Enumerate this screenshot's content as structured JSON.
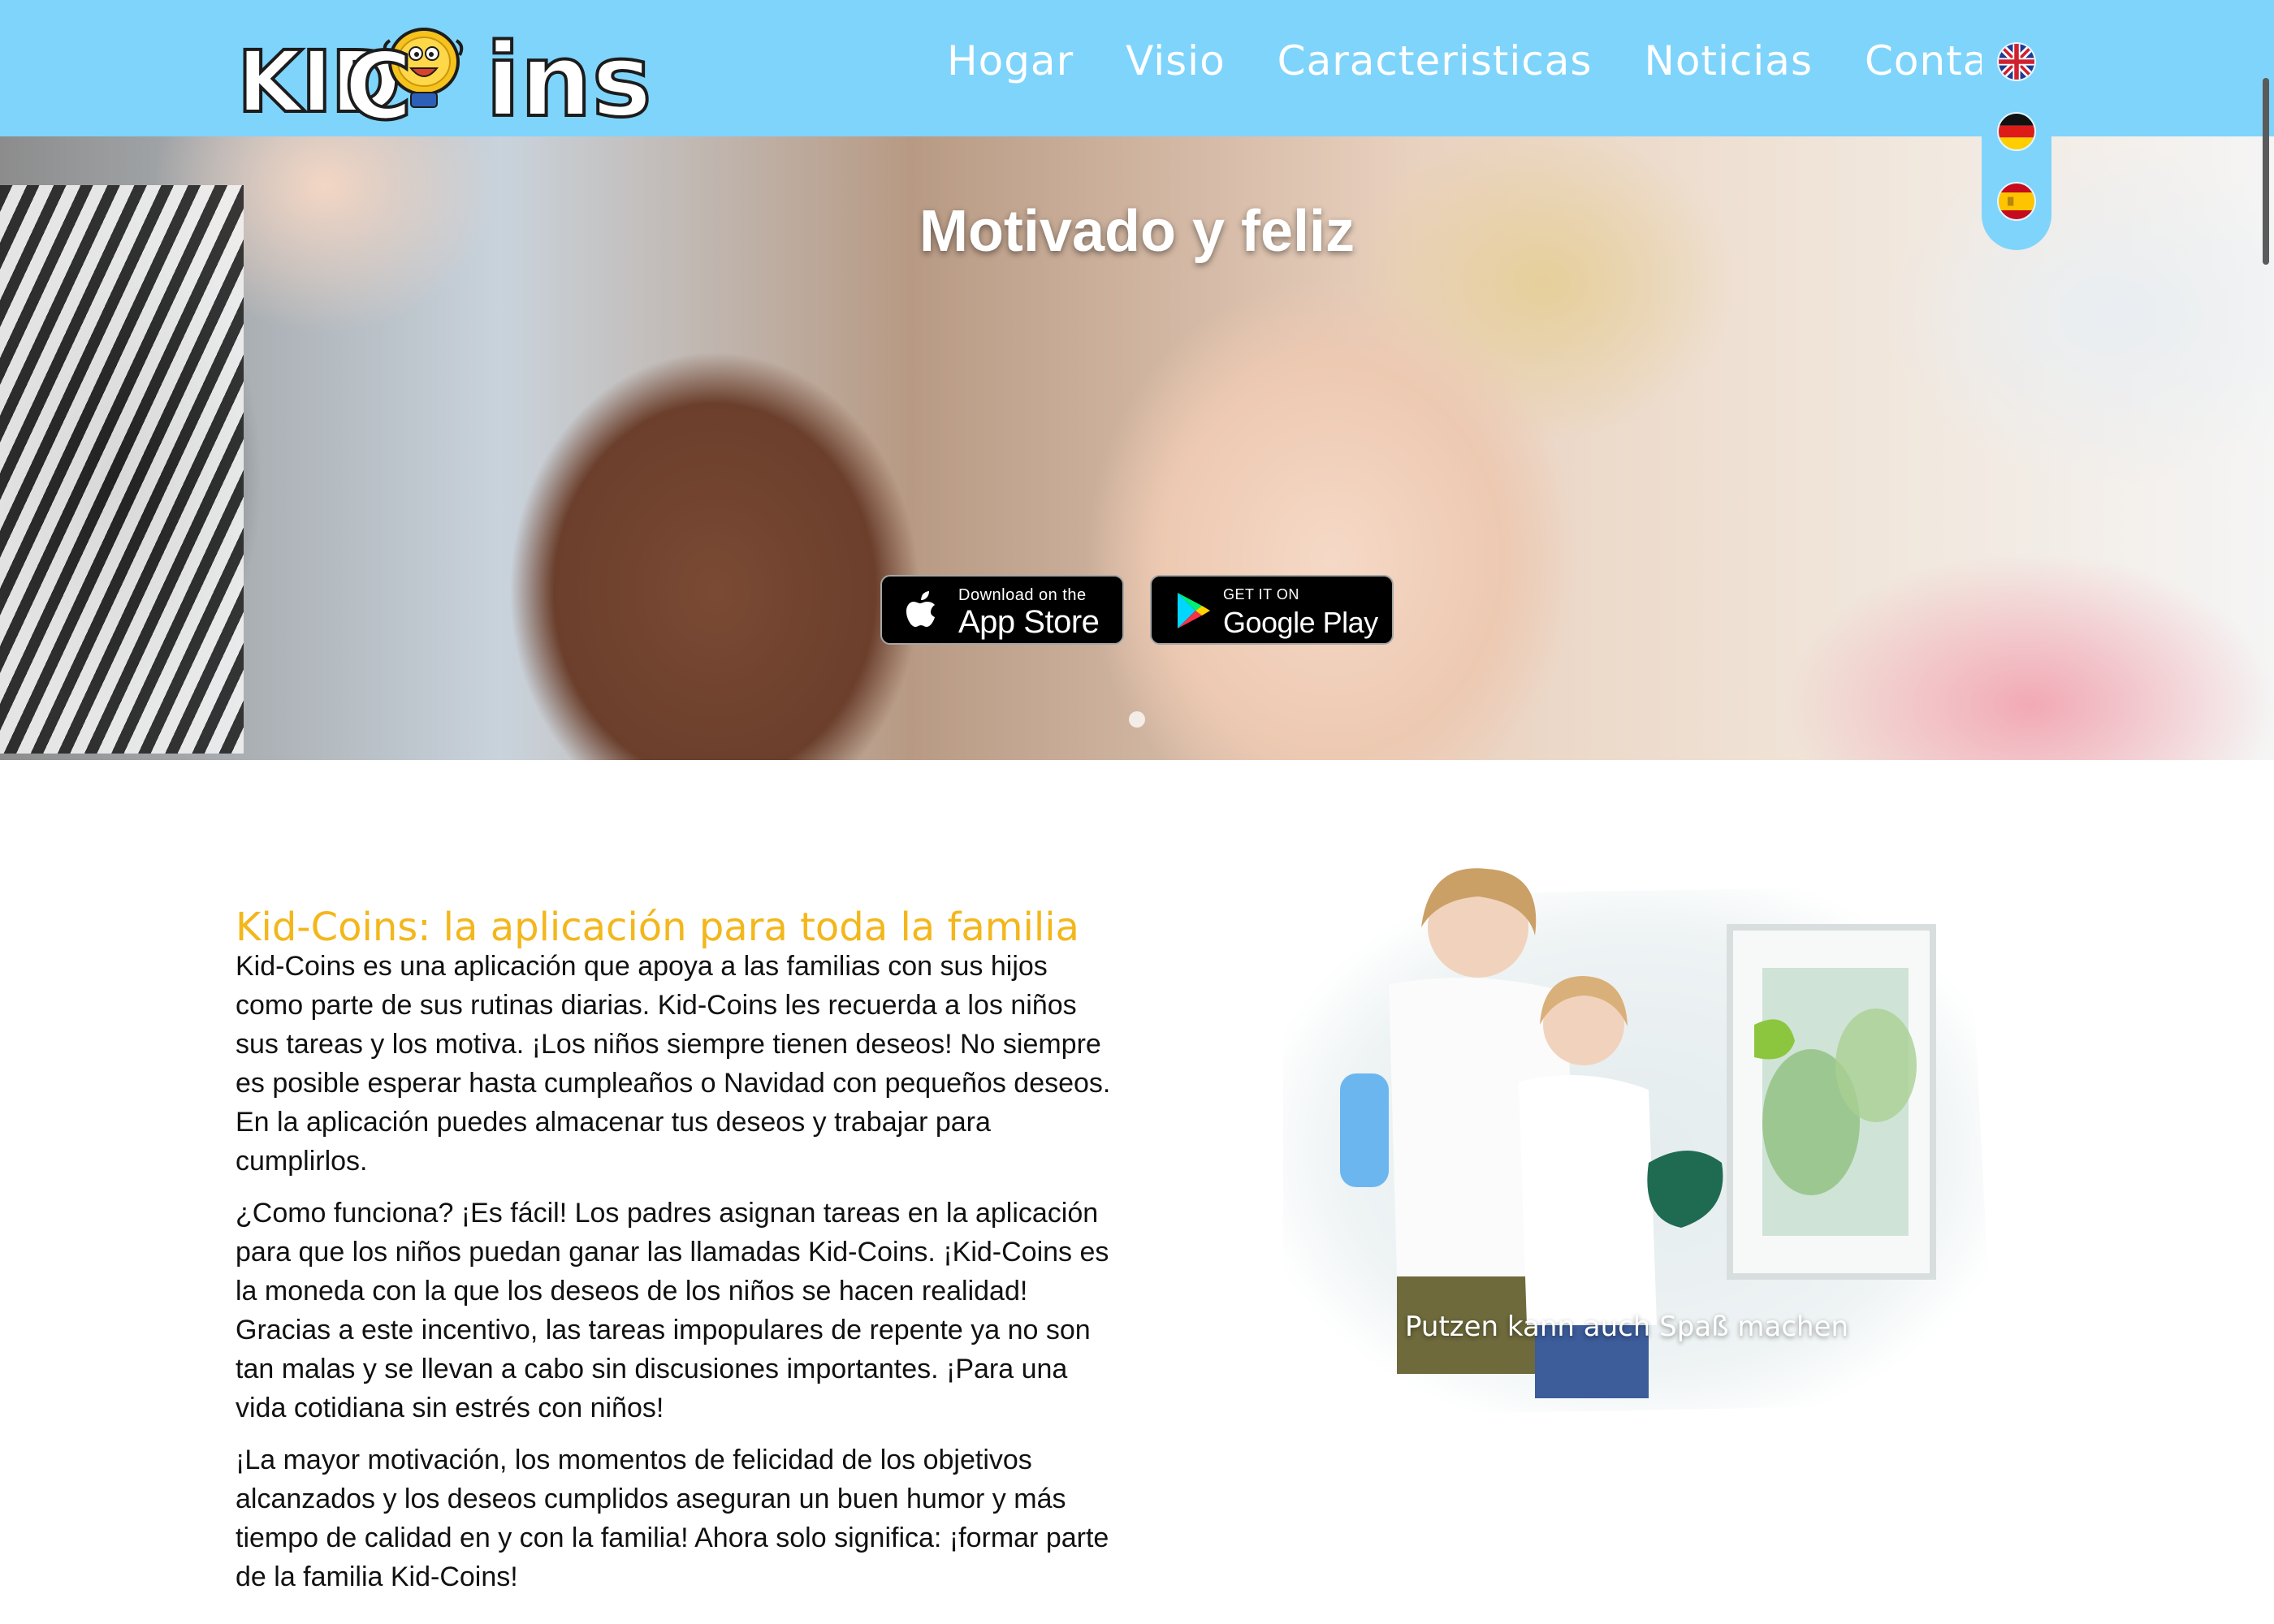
{
  "header": {
    "logo_text": {
      "part1": "KID",
      "part2": "C",
      "part3": "ins"
    },
    "logo_alt": "KidCoins",
    "nav": [
      "Hogar",
      "Visio",
      "Caracteristicas",
      "Noticias",
      "Contacto"
    ],
    "languages": [
      {
        "code": "en",
        "icon": "uk-flag-icon"
      },
      {
        "code": "de",
        "icon": "germany-flag-icon"
      },
      {
        "code": "es",
        "icon": "spain-flag-icon"
      }
    ],
    "bg_color": "#7fd4fb"
  },
  "hero": {
    "title": "Motivado y feliz",
    "app_store": {
      "small": "Download on the",
      "big": "App Store",
      "icon": "apple-icon"
    },
    "google_play": {
      "small": "GET IT ON",
      "big": "Google Play",
      "icon": "google-play-icon"
    }
  },
  "content": {
    "heading": "Kid-Coins: la aplicación para toda la familia",
    "heading_color": "#f3b71c",
    "paragraphs": [
      "Kid-Coins es una aplicación que apoya a las familias con sus hijos como parte de sus rutinas diarias. Kid-Coins les recuerda a los niños sus tareas y los motiva. ¡Los niños siempre tienen deseos! No siempre es posible esperar hasta cumpleaños o Navidad con pequeños deseos. En la aplicación puedes almacenar tus deseos y trabajar para cumplirlos.",
      "¿Como funciona? ¡Es fácil! Los padres asignan tareas en la aplicación para que los niños puedan ganar las llamadas Kid-Coins. ¡Kid-Coins es la moneda con la que los deseos de los niños se hacen realidad! Gracias a este incentivo, las tareas impopulares de repente ya no son tan malas y se llevan a cabo sin discusiones importantes. ¡Para una vida cotidiana sin estrés con niños!",
      "¡La mayor motivación, los momentos de felicidad de los objetivos alcanzados y los deseos cumplidos aseguran un buen humor y más tiempo de calidad en y con la familia! Ahora solo significa: ¡formar parte de la familia Kid-Coins!"
    ],
    "image_caption": "Putzen kann auch Spaß machen"
  }
}
